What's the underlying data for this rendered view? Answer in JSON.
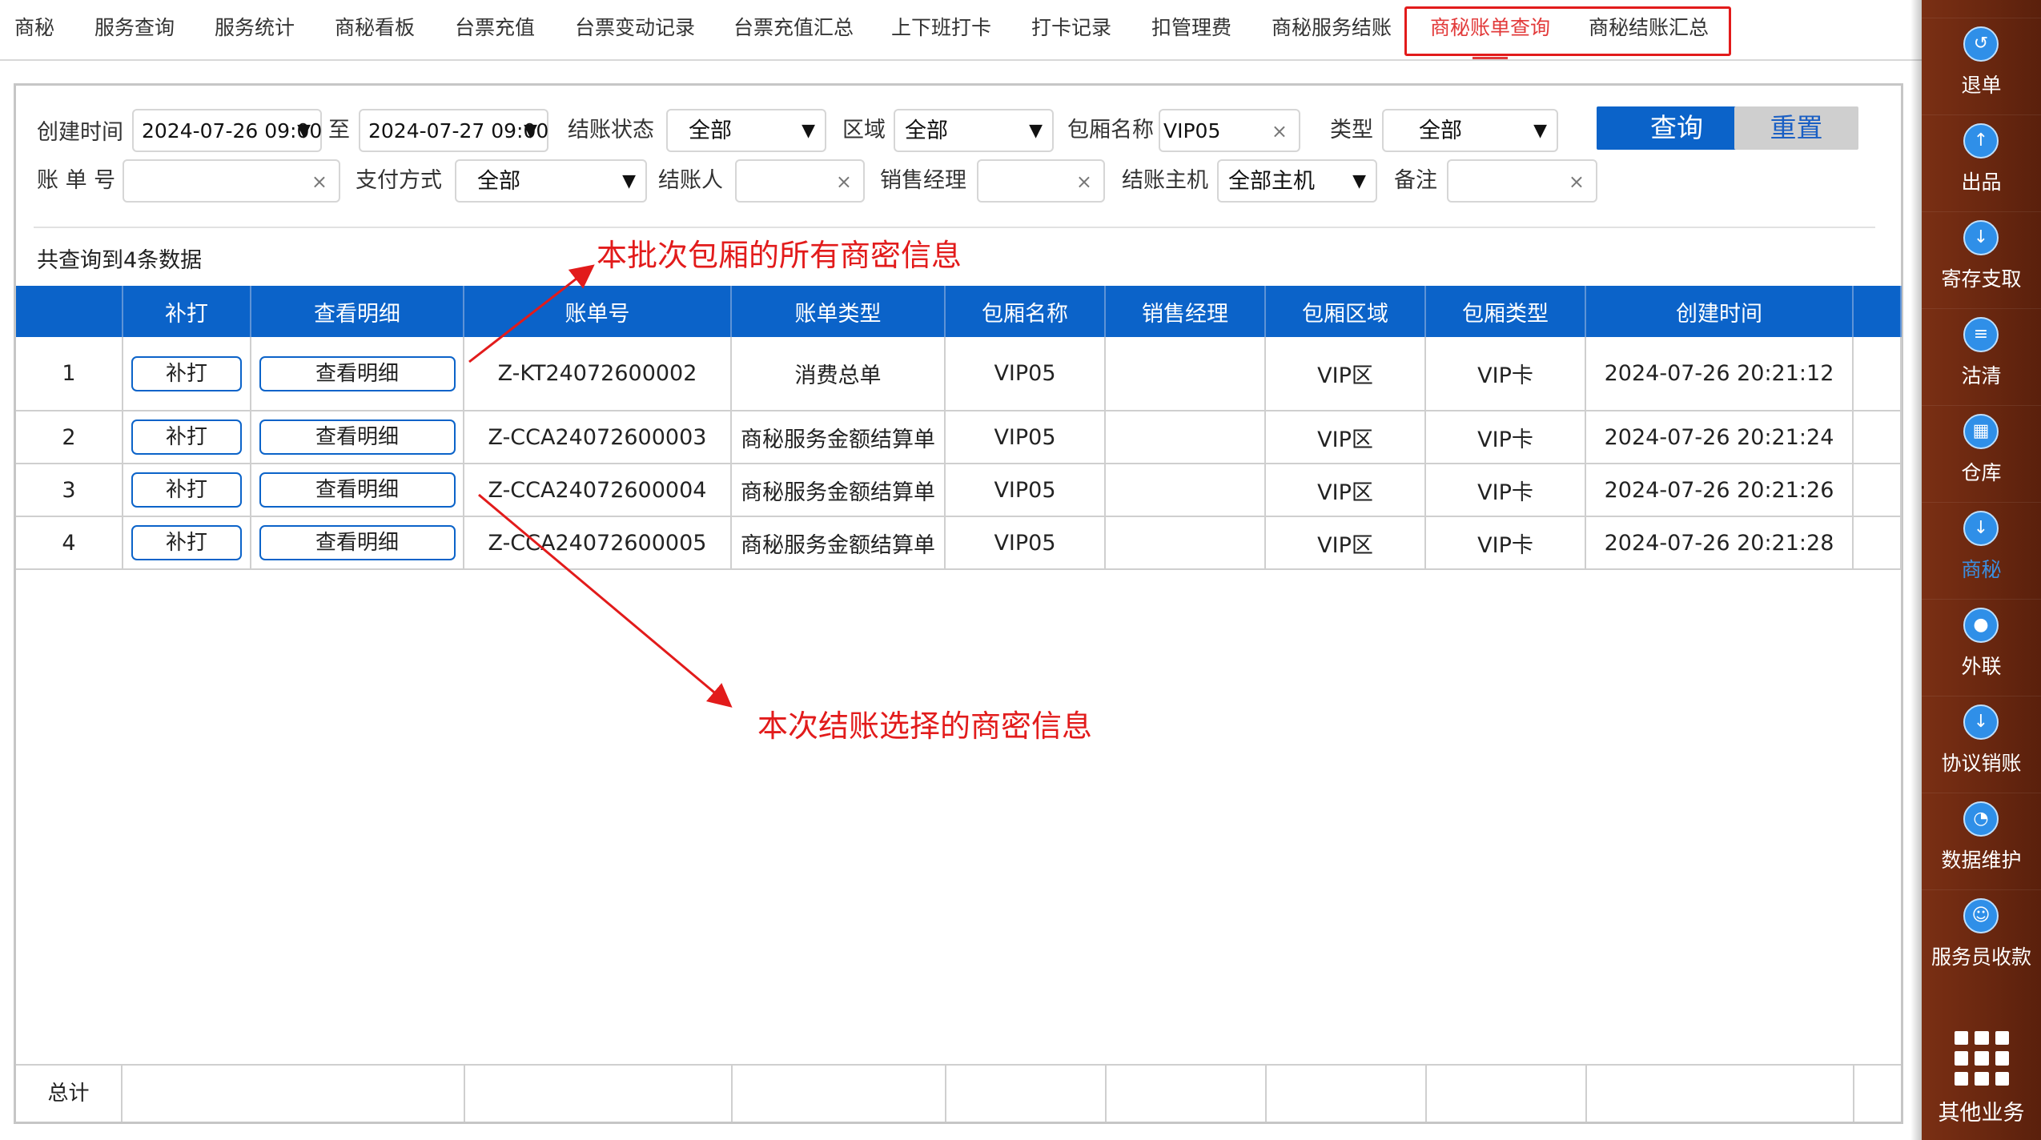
{
  "top_tabs": [
    "商秘",
    "服务查询",
    "服务统计",
    "商秘看板",
    "台票充值",
    "台票变动记录",
    "台票充值汇总",
    "上下班打卡",
    "打卡记录",
    "扣管理费",
    "商秘服务结账",
    "商秘账单查询",
    "商秘结账汇总"
  ],
  "active_tab": "商秘账单查询",
  "filters": {
    "create_time_label": "创建时间",
    "start_time": "2024-07-26 09:00",
    "to_label": "至",
    "end_time": "2024-07-27 09:00",
    "settle_status_label": "结账状态",
    "settle_status_value": "全部",
    "area_label": "区域",
    "area_value": "全部",
    "room_name_label": "包厢名称",
    "room_name_value": "VIP05",
    "type_label": "类型",
    "type_value": "全部",
    "bill_no_label": "账 单 号",
    "bill_no_value": "",
    "payment_label": "支付方式",
    "payment_value": "全部",
    "settler_label": "结账人",
    "settler_value": "",
    "sales_manager_label": "销售经理",
    "sales_manager_value": "",
    "host_label": "结账主机",
    "host_value": "全部主机",
    "remark_label": "备注",
    "remark_value": "",
    "query_button": "查询",
    "reset_button": "重置",
    "clear_symbol": "×",
    "dropdown_symbol": "▼"
  },
  "result_count": "共查询到4条数据",
  "table": {
    "headers": [
      "",
      "补打",
      "查看明细",
      "账单号",
      "账单类型",
      "包厢名称",
      "销售经理",
      "包厢区域",
      "包厢类型",
      "创建时间"
    ],
    "reprint_label": "补打",
    "detail_label": "查看明细",
    "rows": [
      {
        "index": "1",
        "bill_no": "Z-KT24072600002",
        "bill_type": "消费总单",
        "room": "VIP05",
        "sales_manager": "",
        "area": "VIP区",
        "room_type": "VIP卡",
        "created": "2024-07-26 20:21:12"
      },
      {
        "index": "2",
        "bill_no": "Z-CCA24072600003",
        "bill_type": "商秘服务金额结算单",
        "room": "VIP05",
        "sales_manager": "",
        "area": "VIP区",
        "room_type": "VIP卡",
        "created": "2024-07-26 20:21:24"
      },
      {
        "index": "3",
        "bill_no": "Z-CCA24072600004",
        "bill_type": "商秘服务金额结算单",
        "room": "VIP05",
        "sales_manager": "",
        "area": "VIP区",
        "room_type": "VIP卡",
        "created": "2024-07-26 20:21:26"
      },
      {
        "index": "4",
        "bill_no": "Z-CCA24072600005",
        "bill_type": "商秘服务金额结算单",
        "room": "VIP05",
        "sales_manager": "",
        "area": "VIP区",
        "room_type": "VIP卡",
        "created": "2024-07-26 20:21:28"
      }
    ],
    "total_label": "总计"
  },
  "annotations": {
    "top": "本批次包厢的所有商密信息",
    "bottom": "本次结账选择的商密信息",
    "color": "#e21b1b"
  },
  "sidebar": {
    "items": [
      {
        "label": "退单",
        "icon": "return-order-icon"
      },
      {
        "label": "出品",
        "icon": "upload-icon"
      },
      {
        "label": "寄存支取",
        "icon": "download-icon"
      },
      {
        "label": "沽清",
        "icon": "list-sort-icon"
      },
      {
        "label": "仓库",
        "icon": "warehouse-grid-icon"
      },
      {
        "label": "商秘",
        "icon": "download-icon",
        "active": true
      },
      {
        "label": "外联",
        "icon": "contact-icon"
      },
      {
        "label": "协议销账",
        "icon": "download-icon"
      },
      {
        "label": "数据维护",
        "icon": "pie-chart-icon"
      },
      {
        "label": "服务员收款",
        "icon": "cashier-icon"
      }
    ],
    "other_label": "其他业务"
  },
  "colors": {
    "primary_blue": "#0b63c9",
    "active_red": "#e23a3a",
    "sidebar_brown": "#6b2810"
  }
}
